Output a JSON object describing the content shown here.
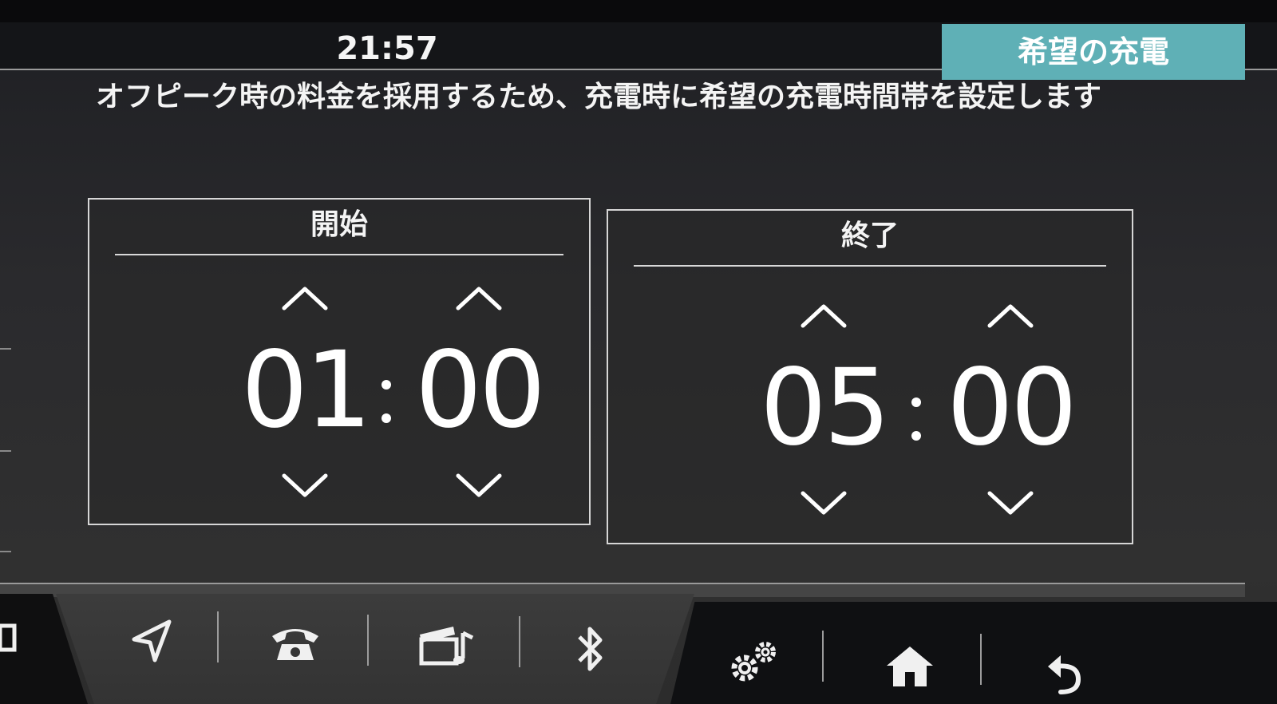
{
  "status": {
    "clock": "21:57"
  },
  "header": {
    "title": "希望の充電"
  },
  "description": "オフピーク時の料金を採用するため、充電時に希望の充電時間帯を設定します",
  "start_panel": {
    "label": "開始",
    "hour": "01",
    "minute": "00"
  },
  "end_panel": {
    "label": "終了",
    "hour": "05",
    "minute": "00"
  },
  "nav": {
    "items": [
      {
        "name": "navigation",
        "icon": "navigation-arrow-icon"
      },
      {
        "name": "phone",
        "icon": "phone-icon"
      },
      {
        "name": "media",
        "icon": "media-clapper-note-icon"
      },
      {
        "name": "bluetooth",
        "icon": "bluetooth-icon"
      },
      {
        "name": "settings",
        "icon": "gears-icon"
      },
      {
        "name": "home",
        "icon": "home-icon"
      },
      {
        "name": "back",
        "icon": "back-arrow-icon"
      }
    ]
  },
  "colors": {
    "accent_teal": "#5fb0b6",
    "background": "#2a2a2d",
    "text": "#f4f4f4"
  }
}
